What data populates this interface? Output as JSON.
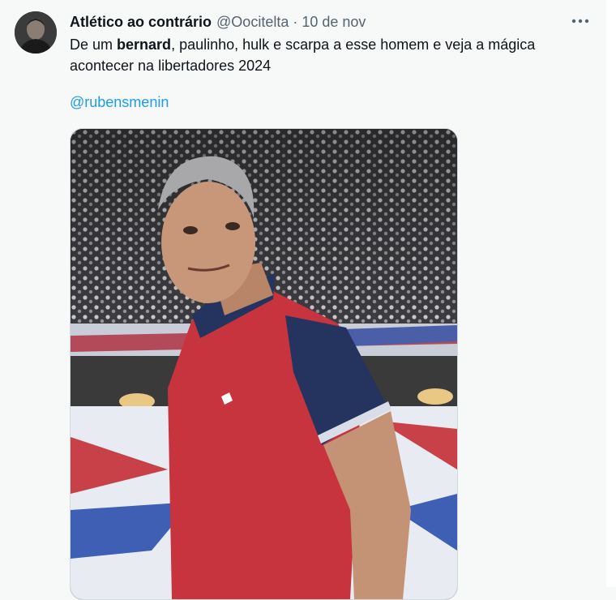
{
  "tweet": {
    "author_name": "Atlético ao contrário",
    "handle": "@Oocitelta",
    "separator": "·",
    "date": "10 de nov",
    "text_before": "De um ",
    "text_bold": "bernard",
    "text_after": ", paulinho, hulk e scarpa a esse homem e veja a mágica acontecer na libertadores 2024",
    "mention": "@rubensmenin"
  },
  "icons": {
    "avatar": "profile-photo",
    "more": "more-horizontal-icon"
  },
  "colors": {
    "link": "#1d9bf0",
    "secondary_text": "#536471",
    "background": "#f7f9f9"
  }
}
